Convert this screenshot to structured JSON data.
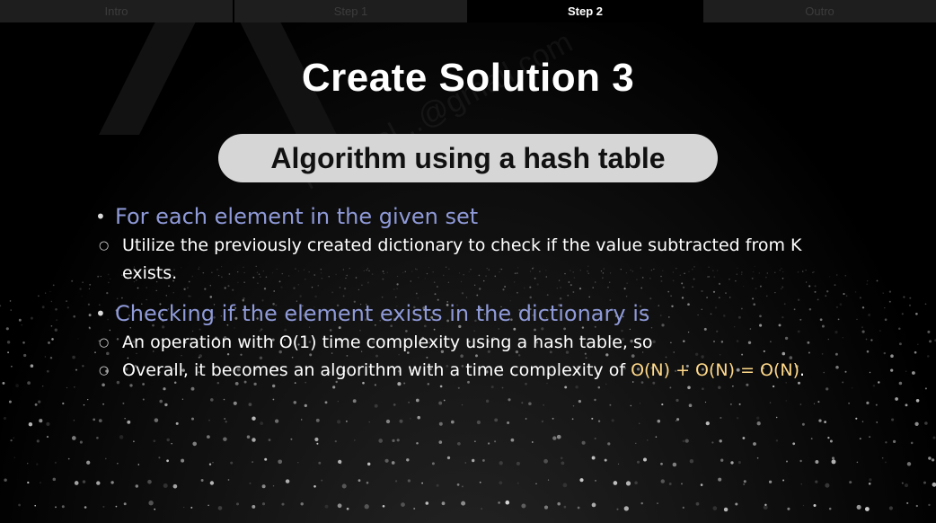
{
  "tabs": [
    {
      "label": "Intro",
      "active": false
    },
    {
      "label": "Step 1",
      "active": false
    },
    {
      "label": "Step 2",
      "active": true
    },
    {
      "label": "Outro",
      "active": false
    }
  ],
  "slide": {
    "title": "Create Solution 3",
    "subtitle": "Algorithm using a hash table",
    "bullets": [
      {
        "text": "For each element in the given set",
        "sub": [
          "Utilize the previously created dictionary to check if the value subtracted from K exists."
        ]
      },
      {
        "text": "Checking if the element exists in the dictionary is",
        "sub": [
          "An operation with O(1) time complexity using a hash table, so",
          "Overall, it becomes an algorithm with a time complexity of "
        ],
        "highlight": "O(N) + O(N) = O(N)",
        "suffix": "."
      }
    ]
  },
  "watermark": "relexsol...@gmail.com",
  "colors": {
    "background": "#000000",
    "tab_inactive": "#1e1e1e",
    "pill": "#d6d6d6",
    "bullet_main": "#8f9ad8",
    "highlight": "#ffd98a"
  }
}
